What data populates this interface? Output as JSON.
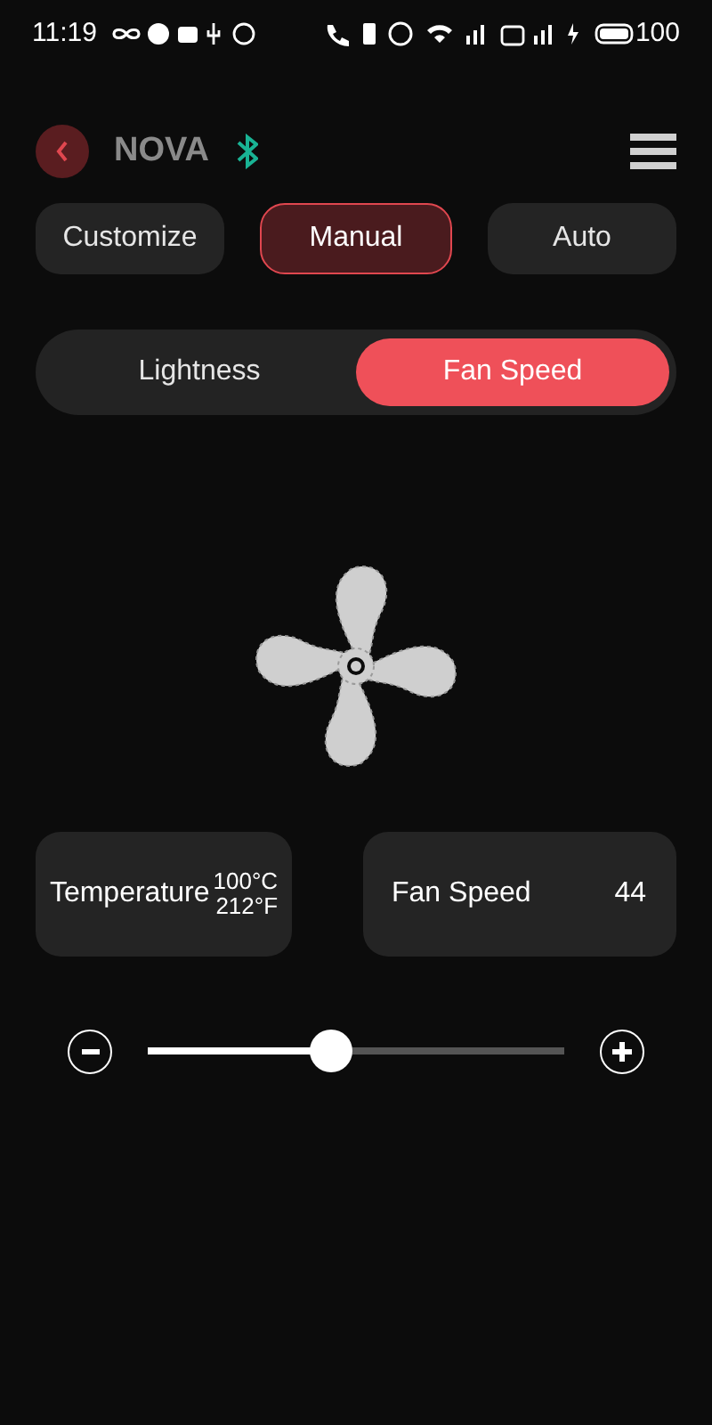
{
  "status_bar": {
    "time": "11:19",
    "battery": "100"
  },
  "header": {
    "title": "NOVA"
  },
  "modes": [
    {
      "label": "Customize",
      "selected": false
    },
    {
      "label": "Manual",
      "selected": true
    },
    {
      "label": "Auto",
      "selected": false
    }
  ],
  "segments": [
    {
      "label": "Lightness",
      "selected": false
    },
    {
      "label": "Fan Speed",
      "selected": true
    }
  ],
  "cards": [
    {
      "label": "Temperature",
      "kind": "temperature",
      "value_c": "100°C",
      "value_f": "212°F"
    },
    {
      "label": "Fan Speed",
      "kind": "speed",
      "value": "44"
    }
  ],
  "slider": {
    "level": 0.44
  }
}
